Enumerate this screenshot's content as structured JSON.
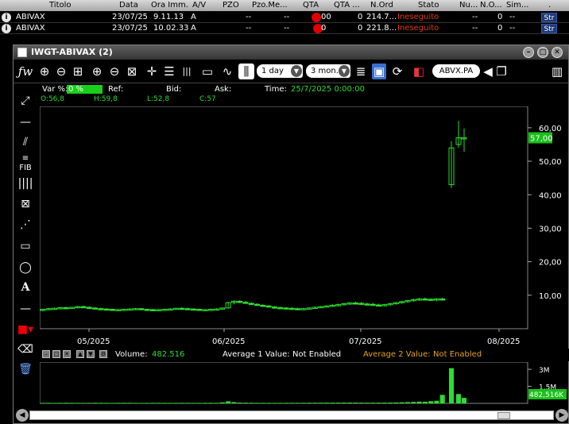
{
  "orders": {
    "headers": [
      "Titolo",
      "Data",
      "Ora Imm.",
      "A/V",
      "PZO",
      "Pzo.Me...",
      "QTA",
      "QTA ...",
      "N.Ord",
      "Stato",
      "Nu...",
      "N.O...",
      "Sim...",
      "."
    ],
    "rows": [
      {
        "titolo": "ABIVAX",
        "data": "23/07/25",
        "ora": "9.11.13",
        "av": "A",
        "pzo": "--",
        "pzome": "--",
        "qta": "00",
        "qta2": "0",
        "nord": "214.7...",
        "stato": "Ineseguito",
        "nu": "--",
        "no": "0",
        "sim": "--",
        "str": "Str"
      },
      {
        "titolo": "ABIVAX",
        "data": "23/07/25",
        "ora": "10.02.33",
        "av": "A",
        "pzo": "--",
        "pzome": "--",
        "qta": "0",
        "qta2": "0",
        "nord": "221.8...",
        "stato": "Ineseguito",
        "nu": "--",
        "no": "0",
        "sim": "--",
        "str": "Str"
      }
    ]
  },
  "window": {
    "title": "IWGT-ABIVAX (2)",
    "interval": "1 day",
    "range": "3 mon..",
    "symbol": "ABVX.PA"
  },
  "info": {
    "var_label": "Var %:",
    "var_value": "0 %",
    "ref_label": "Ref:",
    "bid_label": "Bid:",
    "ask_label": "Ask:",
    "time_label": "Time:",
    "time_value": "25/7/2025 0:00:00",
    "open": "O:56,8",
    "high": "H:59,8",
    "low": "L:52,8",
    "close": "C:57"
  },
  "volume_bar": {
    "volume_label": "Volume:",
    "volume_value": "482.516",
    "avg1_label": "Average 1 Value:",
    "avg1_value": "Not Enabled",
    "avg2_label": "Average 2 Value:",
    "avg2_value": "Not Enabled"
  },
  "colors": {
    "accent": "#2ddd2d",
    "avg2": "#e6a21b",
    "status": "#e03b12",
    "candle": "#2ddd2d"
  },
  "chart_data": [
    {
      "type": "candlestick",
      "x_ticks": [
        "05/2025",
        "06/2025",
        "07/2025",
        "08/2025"
      ],
      "y_ticks": [
        "10,00",
        "20,00",
        "30,00",
        "40,00",
        "50,00",
        "60,00"
      ],
      "ylim": [
        0,
        64
      ],
      "last_price_label": "57,00",
      "last_price": 57,
      "candles": [
        {
          "o": 5.5,
          "h": 6.0,
          "l": 5.2,
          "c": 5.8
        },
        {
          "o": 5.8,
          "h": 6.2,
          "l": 5.6,
          "c": 6.0
        },
        {
          "o": 6.0,
          "h": 6.3,
          "l": 5.8,
          "c": 6.1
        },
        {
          "o": 6.1,
          "h": 6.5,
          "l": 5.9,
          "c": 6.3
        },
        {
          "o": 6.3,
          "h": 6.6,
          "l": 6.0,
          "c": 6.2
        },
        {
          "o": 6.2,
          "h": 6.5,
          "l": 6.0,
          "c": 6.4
        },
        {
          "o": 6.4,
          "h": 6.8,
          "l": 6.1,
          "c": 6.6
        },
        {
          "o": 6.6,
          "h": 6.9,
          "l": 6.2,
          "c": 6.4
        },
        {
          "o": 6.4,
          "h": 6.7,
          "l": 6.0,
          "c": 6.2
        },
        {
          "o": 6.2,
          "h": 6.4,
          "l": 5.8,
          "c": 6.0
        },
        {
          "o": 6.0,
          "h": 6.3,
          "l": 5.7,
          "c": 5.9
        },
        {
          "o": 5.9,
          "h": 6.1,
          "l": 5.6,
          "c": 5.8
        },
        {
          "o": 5.8,
          "h": 6.0,
          "l": 5.5,
          "c": 5.6
        },
        {
          "o": 5.6,
          "h": 5.9,
          "l": 5.4,
          "c": 5.7
        },
        {
          "o": 5.7,
          "h": 6.0,
          "l": 5.5,
          "c": 5.8
        },
        {
          "o": 5.8,
          "h": 6.1,
          "l": 5.6,
          "c": 5.9
        },
        {
          "o": 5.9,
          "h": 6.2,
          "l": 5.7,
          "c": 6.0
        },
        {
          "o": 6.0,
          "h": 6.2,
          "l": 5.7,
          "c": 5.8
        },
        {
          "o": 5.8,
          "h": 6.0,
          "l": 5.5,
          "c": 5.7
        },
        {
          "o": 5.7,
          "h": 5.9,
          "l": 5.4,
          "c": 5.6
        },
        {
          "o": 5.6,
          "h": 5.9,
          "l": 5.4,
          "c": 5.7
        },
        {
          "o": 5.7,
          "h": 6.0,
          "l": 5.5,
          "c": 5.8
        },
        {
          "o": 5.8,
          "h": 6.1,
          "l": 5.6,
          "c": 5.9
        },
        {
          "o": 5.9,
          "h": 6.2,
          "l": 5.7,
          "c": 6.1
        },
        {
          "o": 6.1,
          "h": 6.4,
          "l": 5.8,
          "c": 6.0
        },
        {
          "o": 6.0,
          "h": 6.3,
          "l": 5.7,
          "c": 5.9
        },
        {
          "o": 5.9,
          "h": 6.1,
          "l": 5.6,
          "c": 5.8
        },
        {
          "o": 5.8,
          "h": 6.0,
          "l": 5.5,
          "c": 5.6
        },
        {
          "o": 5.6,
          "h": 5.9,
          "l": 5.4,
          "c": 5.7
        },
        {
          "o": 5.7,
          "h": 6.0,
          "l": 5.5,
          "c": 5.8
        },
        {
          "o": 5.8,
          "h": 6.1,
          "l": 5.6,
          "c": 5.9
        },
        {
          "o": 5.9,
          "h": 6.3,
          "l": 5.7,
          "c": 6.2
        },
        {
          "o": 6.2,
          "h": 8.0,
          "l": 6.0,
          "c": 7.8
        },
        {
          "o": 7.8,
          "h": 8.5,
          "l": 7.3,
          "c": 8.2
        },
        {
          "o": 8.2,
          "h": 8.6,
          "l": 7.6,
          "c": 7.9
        },
        {
          "o": 7.9,
          "h": 8.3,
          "l": 7.4,
          "c": 7.6
        },
        {
          "o": 7.6,
          "h": 7.9,
          "l": 7.1,
          "c": 7.3
        },
        {
          "o": 7.3,
          "h": 7.6,
          "l": 6.8,
          "c": 7.0
        },
        {
          "o": 7.0,
          "h": 7.3,
          "l": 6.5,
          "c": 6.8
        },
        {
          "o": 6.8,
          "h": 7.1,
          "l": 6.3,
          "c": 6.5
        },
        {
          "o": 6.5,
          "h": 6.8,
          "l": 6.0,
          "c": 6.3
        },
        {
          "o": 6.3,
          "h": 6.6,
          "l": 5.9,
          "c": 6.2
        },
        {
          "o": 6.2,
          "h": 6.5,
          "l": 5.9,
          "c": 6.1
        },
        {
          "o": 6.1,
          "h": 6.4,
          "l": 5.8,
          "c": 6.0
        },
        {
          "o": 6.0,
          "h": 6.3,
          "l": 5.7,
          "c": 5.9
        },
        {
          "o": 5.9,
          "h": 6.2,
          "l": 5.6,
          "c": 6.0
        },
        {
          "o": 6.0,
          "h": 6.4,
          "l": 5.8,
          "c": 6.2
        },
        {
          "o": 6.2,
          "h": 6.6,
          "l": 6.0,
          "c": 6.4
        },
        {
          "o": 6.4,
          "h": 6.8,
          "l": 6.2,
          "c": 6.6
        },
        {
          "o": 6.6,
          "h": 7.0,
          "l": 6.4,
          "c": 6.8
        },
        {
          "o": 6.8,
          "h": 7.3,
          "l": 6.5,
          "c": 7.0
        },
        {
          "o": 7.0,
          "h": 7.5,
          "l": 6.7,
          "c": 7.2
        },
        {
          "o": 7.2,
          "h": 7.7,
          "l": 6.9,
          "c": 7.5
        },
        {
          "o": 7.5,
          "h": 7.9,
          "l": 7.1,
          "c": 7.7
        },
        {
          "o": 7.7,
          "h": 8.1,
          "l": 7.3,
          "c": 7.6
        },
        {
          "o": 7.6,
          "h": 8.0,
          "l": 7.2,
          "c": 7.4
        },
        {
          "o": 7.4,
          "h": 7.8,
          "l": 7.0,
          "c": 7.3
        },
        {
          "o": 7.3,
          "h": 7.7,
          "l": 6.9,
          "c": 7.1
        },
        {
          "o": 7.1,
          "h": 7.5,
          "l": 6.8,
          "c": 7.0
        },
        {
          "o": 7.0,
          "h": 7.4,
          "l": 6.7,
          "c": 7.2
        },
        {
          "o": 7.2,
          "h": 7.7,
          "l": 6.9,
          "c": 7.5
        },
        {
          "o": 7.5,
          "h": 8.0,
          "l": 7.2,
          "c": 7.8
        },
        {
          "o": 7.8,
          "h": 8.3,
          "l": 7.5,
          "c": 8.1
        },
        {
          "o": 8.1,
          "h": 8.6,
          "l": 7.8,
          "c": 8.4
        },
        {
          "o": 8.4,
          "h": 9.0,
          "l": 8.1,
          "c": 8.7
        },
        {
          "o": 8.7,
          "h": 9.2,
          "l": 8.3,
          "c": 8.9
        },
        {
          "o": 8.9,
          "h": 9.3,
          "l": 8.4,
          "c": 8.8
        },
        {
          "o": 8.8,
          "h": 9.1,
          "l": 8.3,
          "c": 8.6
        },
        {
          "o": 8.6,
          "h": 9.1,
          "l": 8.2,
          "c": 8.9
        },
        {
          "o": 8.9,
          "h": 9.3,
          "l": 8.5,
          "c": 8.7
        },
        {
          "o": 43.0,
          "h": 56.0,
          "l": 42.0,
          "c": 54.0
        },
        {
          "o": 55.0,
          "h": 62.0,
          "l": 54.0,
          "c": 57.0
        },
        {
          "o": 56.8,
          "h": 59.8,
          "l": 52.8,
          "c": 57.0
        }
      ]
    },
    {
      "type": "bar",
      "name": "Volume",
      "y_ticks": [
        "1,5M",
        "3M"
      ],
      "ylim": [
        0,
        3500000
      ],
      "last_value_label": "482,516K",
      "values": [
        40000,
        45000,
        38000,
        42000,
        50000,
        47000,
        41000,
        39000,
        44000,
        52000,
        48000,
        43000,
        40000,
        46000,
        51000,
        49000,
        42000,
        38000,
        41000,
        45000,
        47000,
        43000,
        40000,
        44000,
        46000,
        42000,
        39000,
        41000,
        45000,
        48000,
        43000,
        90000,
        180000,
        110000,
        70000,
        60000,
        52000,
        48000,
        46000,
        44000,
        42000,
        45000,
        47000,
        50000,
        48000,
        52000,
        55000,
        58000,
        60000,
        62000,
        64000,
        66000,
        70000,
        72000,
        68000,
        65000,
        62000,
        60000,
        64000,
        68000,
        72000,
        80000,
        95000,
        110000,
        130000,
        150000,
        140000,
        190000,
        230000,
        750000,
        3100000,
        820000,
        482516
      ]
    }
  ]
}
